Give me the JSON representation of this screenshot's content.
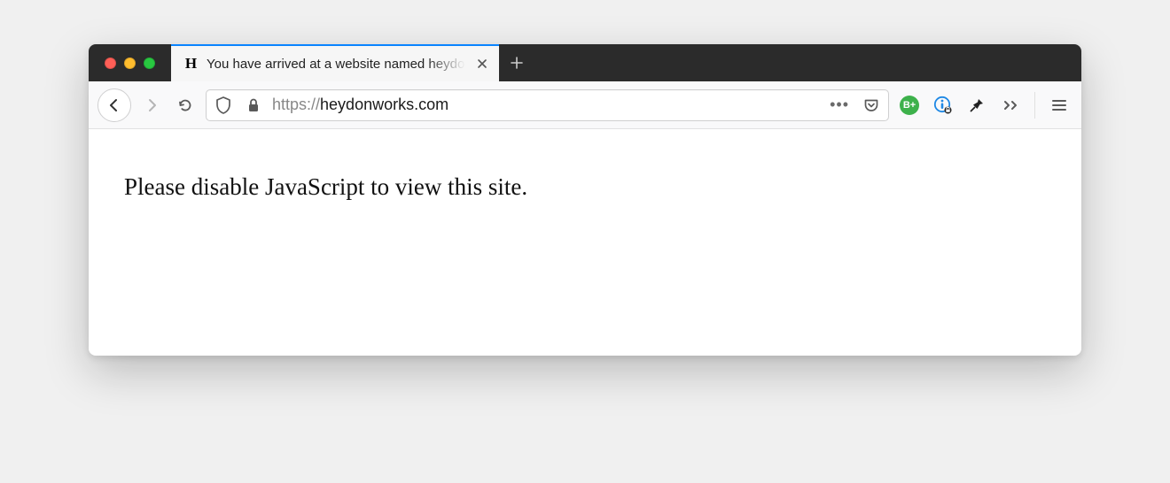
{
  "tab": {
    "favicon_text": "H",
    "title": "You have arrived at a website named heydonworks"
  },
  "url": {
    "protocol": "https://",
    "domain": "heydonworks.com",
    "path": ""
  },
  "extensions": {
    "badge_label": "B+"
  },
  "page": {
    "message": "Please disable JavaScript to view this site."
  }
}
